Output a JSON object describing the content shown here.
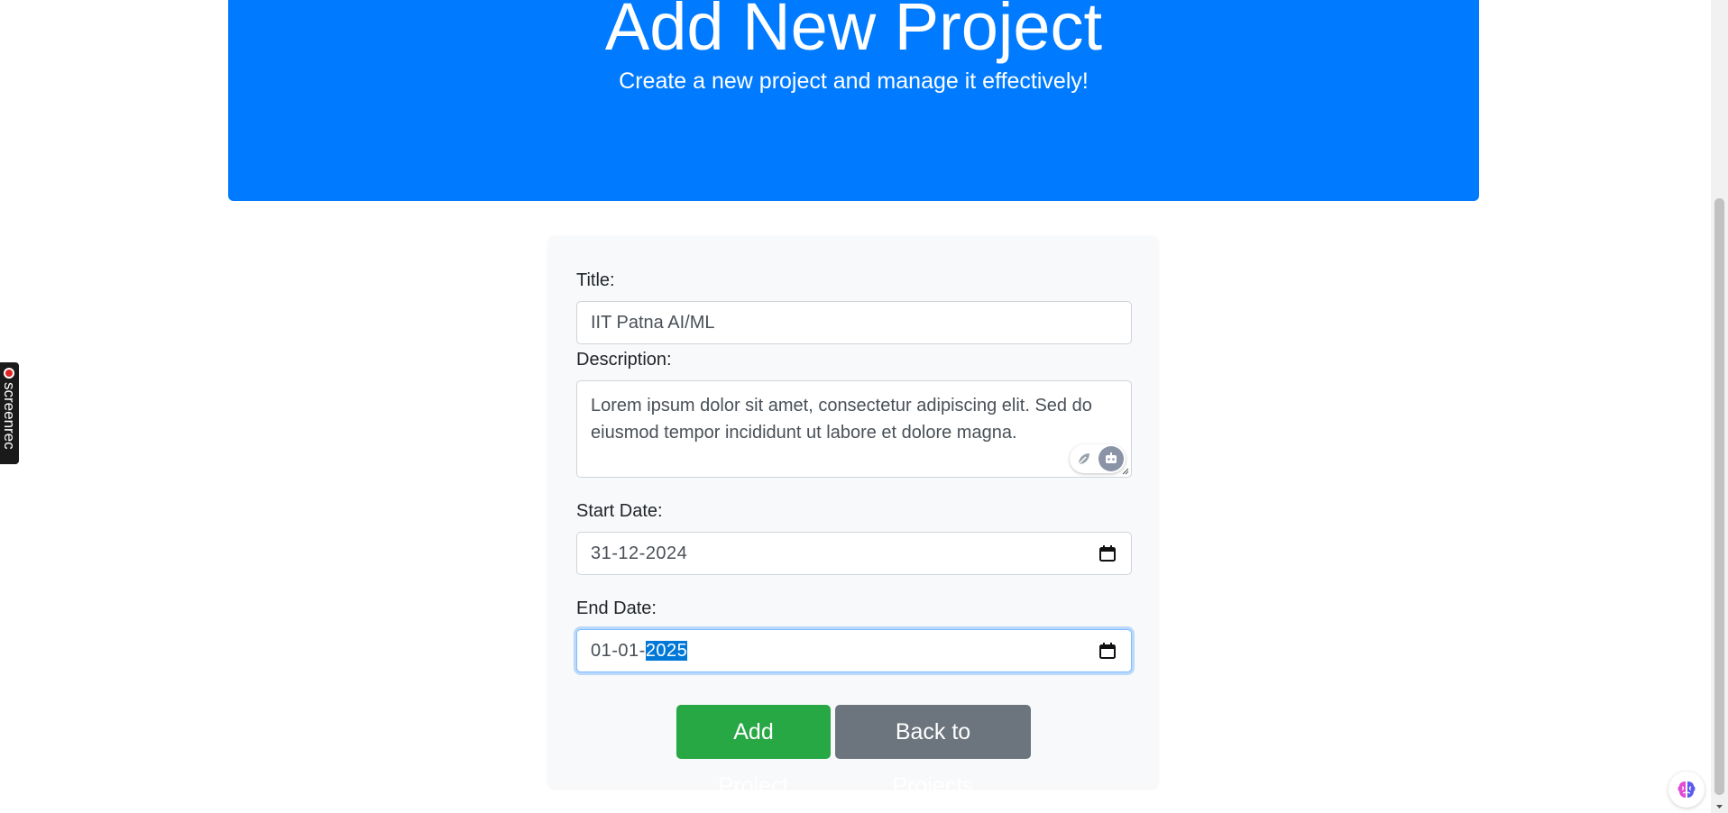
{
  "hero": {
    "title": "Add New Project",
    "subtitle": "Create a new project and manage it effectively!"
  },
  "form": {
    "title_label": "Title:",
    "title_value": "IIT Patna AI/ML",
    "description_label": "Description:",
    "description_value": "Lorem ipsum dolor sit amet, consectetur adipiscing elit. Sed do eiusmod tempor incididunt ut labore et dolore magna.",
    "start_date_label": "Start Date:",
    "start_date_value": "31-12-2024",
    "end_date_label": "End Date:",
    "end_date_prefix": "01-01-",
    "end_date_selected": "2025",
    "add_button": "Add Project",
    "back_button": "Back to Projects"
  },
  "widgets": {
    "screenrec_label": "screenrec"
  },
  "colors": {
    "primary": "#007bff",
    "success": "#28a745",
    "secondary": "#6c757d",
    "card_bg": "#f8f9fa"
  },
  "icons": [
    "calendar-icon",
    "leaf-icon",
    "robot-icon",
    "record-icon",
    "brain-icon",
    "resize-grip-icon"
  ]
}
